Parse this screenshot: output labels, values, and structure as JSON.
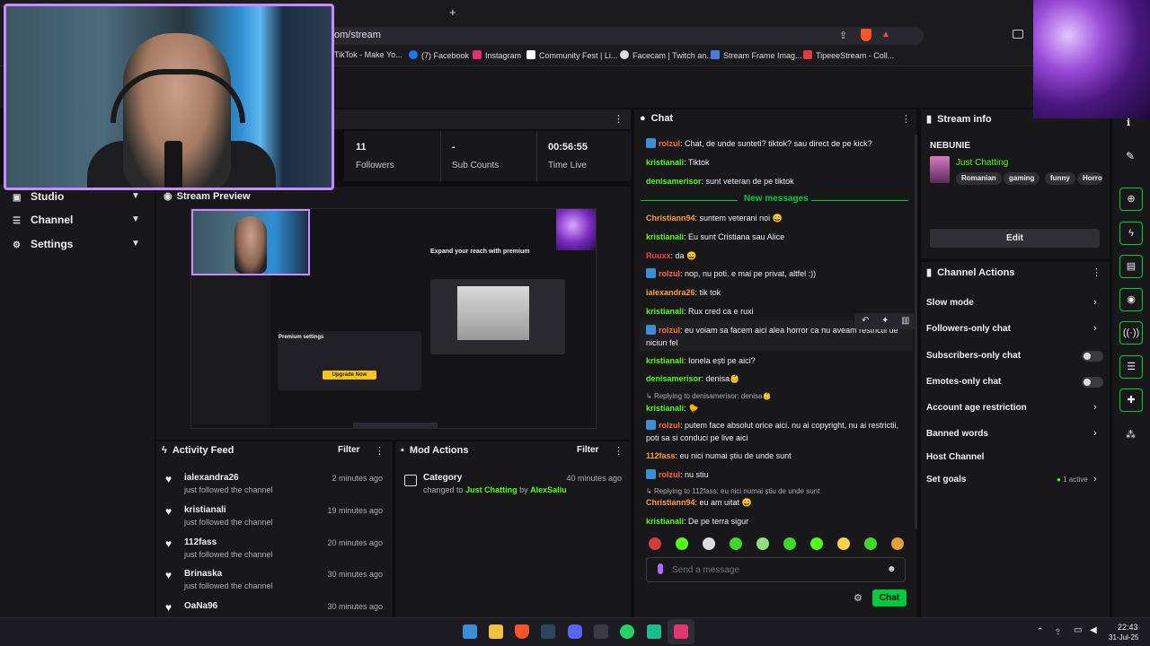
{
  "browser": {
    "new_tab": "+",
    "url": "om/stream",
    "bookmarks": [
      {
        "label": "TikTok - Make Yo...",
        "color": "#000000"
      },
      {
        "label": "(7) Facebook",
        "color": "#1877f2"
      },
      {
        "label": "Instagram",
        "color": "#e1306c"
      },
      {
        "label": "Community Fest | Li...",
        "color": "#ffffff"
      },
      {
        "label": "Facecam | Twitch an...",
        "color": "#dcdce0"
      },
      {
        "label": "Stream Frame Imag...",
        "color": "#4a7bd6"
      },
      {
        "label": "TipeeeStream - Coll...",
        "color": "#e23b3b"
      }
    ]
  },
  "sidebar": {
    "items": [
      {
        "label": "Studio",
        "icon": "video-icon"
      },
      {
        "label": "Channel",
        "icon": "list-icon"
      },
      {
        "label": "Settings",
        "icon": "gear-icon"
      }
    ]
  },
  "stats": [
    {
      "value": "11",
      "label": "Followers"
    },
    {
      "value": "-",
      "label": "Sub Counts"
    },
    {
      "value": "00:56:55",
      "label": "Time Live"
    }
  ],
  "preview": {
    "title": "Stream Preview",
    "overlay_heading": "Expand your reach with premium",
    "upgrade_label": "Upgrade Now",
    "premium_label": "Premium settings"
  },
  "activity_feed": {
    "title": "Activity Feed",
    "filter": "Filter",
    "items": [
      {
        "name": "ialexandra26",
        "action": "just followed the channel",
        "time": "2 minutes ago"
      },
      {
        "name": "kristianali",
        "action": "just followed the channel",
        "time": "19 minutes ago"
      },
      {
        "name": "112fass",
        "action": "just followed the channel",
        "time": "20 minutes ago"
      },
      {
        "name": "Brinaska",
        "action": "just followed the channel",
        "time": "30 minutes ago"
      },
      {
        "name": "OaNa96",
        "action": "",
        "time": "30 minutes ago"
      }
    ]
  },
  "mod_actions": {
    "title": "Mod Actions",
    "filter": "Filter",
    "item": {
      "title": "Category",
      "prefix": "changed to",
      "category": "Just Chatting",
      "by": "by",
      "moderator": "AlexSaliu",
      "time": "40 minutes ago"
    }
  },
  "chat": {
    "title": "Chat",
    "new_messages": "New messages",
    "messages": [
      {
        "user": "rolzul",
        "color": "#ff6a3d",
        "badge": true,
        "text": "Chat, de unde sunteti? tiktok? sau direct de pe kick?"
      },
      {
        "user": "kristianali",
        "color": "#53fc18",
        "badge": false,
        "text": "Tiktok"
      },
      {
        "user": "denisamerisor",
        "color": "#53fc18",
        "badge": false,
        "text": "sunt veteran de pe tiktok"
      },
      {
        "user": "Christiann94",
        "color": "#ff9d3d",
        "badge": false,
        "text": "suntem veterani noi 😄"
      },
      {
        "user": "kristianali",
        "color": "#53fc18",
        "badge": false,
        "text": "Eu sunt Cristiana sau Alice"
      },
      {
        "user": "Ruuxx",
        "color": "#ff3d3d",
        "badge": false,
        "text": "da 😄"
      },
      {
        "user": "rolzul",
        "color": "#ff6a3d",
        "badge": true,
        "text": "nop, nu poti. e mai pe privat, altfel :))"
      },
      {
        "user": "ialexandra26",
        "color": "#ff9d3d",
        "badge": false,
        "text": "tik tok"
      },
      {
        "user": "kristianali",
        "color": "#53fc18",
        "badge": false,
        "text": "Rux cred ca e ruxi"
      },
      {
        "user": "rolzul",
        "color": "#ff6a3d",
        "badge": true,
        "text": "eu voiam sa facem aici alea horror ca nu aveam restrictii de niciun fel"
      },
      {
        "user": "kristianali",
        "color": "#53fc18",
        "badge": false,
        "text": "Ionela ești pe aici?"
      },
      {
        "user": "denisamerisor",
        "color": "#53fc18",
        "badge": false,
        "text": "denisa👶"
      },
      {
        "user": "kristianali",
        "color": "#53fc18",
        "badge": false,
        "text": "🐤"
      },
      {
        "user": "rolzul",
        "color": "#ff6a3d",
        "badge": true,
        "text": "putem face absolut orice aici. nu ai copyright, nu ai restrictii, poti sa si conduci pe live aici"
      },
      {
        "user": "112fass",
        "color": "#ff9d3d",
        "badge": false,
        "text": "eu nici numai știu de unde sunt"
      },
      {
        "user": "rolzul",
        "color": "#ff6a3d",
        "badge": true,
        "text": "nu stiu"
      },
      {
        "user": "Christiann94",
        "color": "#ff9d3d",
        "badge": false,
        "text": "eu am uitat 😄"
      },
      {
        "user": "kristianali",
        "color": "#53fc18",
        "badge": false,
        "text": "De pe terra sigur"
      }
    ],
    "replies": [
      "Replying to denisamerisor: denisa👶",
      "Replying to 112fass: eu nici numai știu de unde sunt"
    ],
    "input_placeholder": "Send a message",
    "send_label": "Chat"
  },
  "stream_info": {
    "title": "Stream info",
    "stream_title": "NEBUNIE",
    "category": "Just Chatting",
    "tags": [
      "Romanian",
      "gaming",
      "funny",
      "Horro"
    ],
    "edit_label": "Edit"
  },
  "channel_actions": {
    "title": "Channel Actions",
    "items": [
      {
        "label": "Slow mode",
        "control": "chevron"
      },
      {
        "label": "Followers-only chat",
        "control": "chevron"
      },
      {
        "label": "Subscribers-only chat",
        "control": "toggle"
      },
      {
        "label": "Emotes-only chat",
        "control": "toggle"
      },
      {
        "label": "Account age restriction",
        "control": "chevron"
      },
      {
        "label": "Banned words",
        "control": "chevron"
      },
      {
        "label": "Host Channel",
        "control": "none"
      },
      {
        "label": "Set goals",
        "control": "chevron",
        "badge": "1 active"
      }
    ]
  },
  "taskbar": {
    "time": "22:43",
    "date": "31-Jul-25"
  },
  "colors": {
    "accent": "#00c93e",
    "bg": "#0e0e10",
    "panel": "#18181b"
  }
}
